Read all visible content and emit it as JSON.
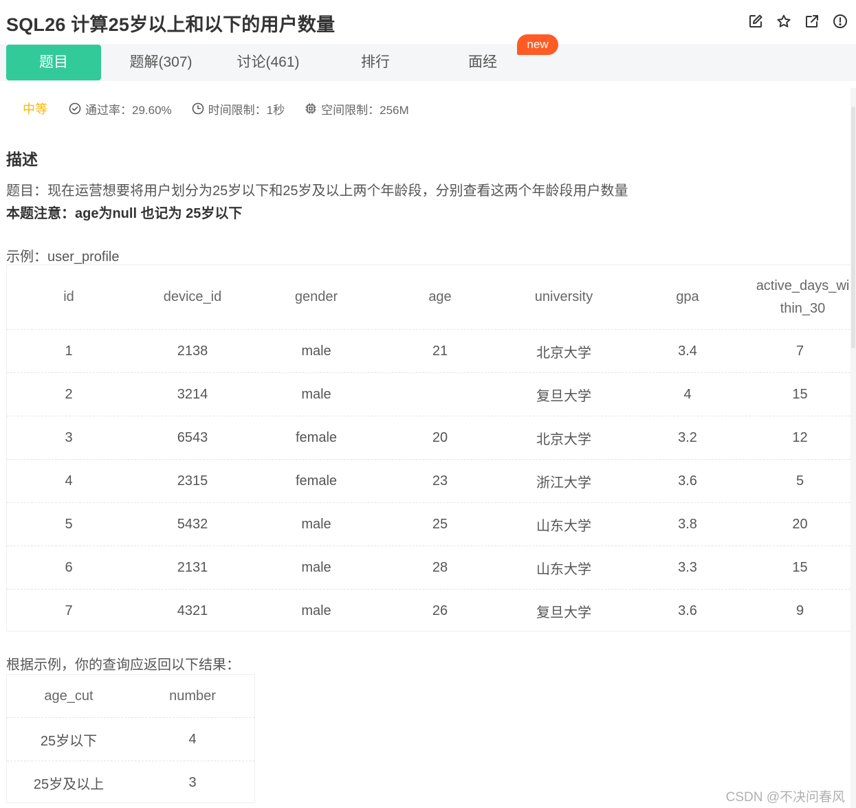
{
  "problem": {
    "title": "SQL26  计算25岁以上和以下的用户数量"
  },
  "header_actions": [
    {
      "icon": "edit-icon",
      "label": "编辑"
    },
    {
      "icon": "star-icon",
      "label": "收藏"
    },
    {
      "icon": "share-icon",
      "label": "分享"
    },
    {
      "icon": "report-icon",
      "label": "反馈"
    }
  ],
  "tabs": [
    {
      "label": "题目",
      "active": true
    },
    {
      "label": "题解(307)",
      "active": false
    },
    {
      "label": "讨论(461)",
      "active": false
    },
    {
      "label": "排行",
      "active": false
    },
    {
      "label": "面经",
      "active": false
    }
  ],
  "new_badge": "new",
  "meta": {
    "difficulty": "中等",
    "pass_rate": "通过率：29.60%",
    "time_limit": "时间限制：1秒",
    "space_limit": "空间限制：256M"
  },
  "description": {
    "heading": "描述",
    "text": "题目：现在运营想要将用户划分为25岁以下和25岁及以上两个年龄段，分别查看这两个年龄段用户数量",
    "note": "本题注意：age为null 也记为 25岁以下"
  },
  "example": {
    "label": "示例：user_profile",
    "columns": [
      "id",
      "device_id",
      "gender",
      "age",
      "university",
      "gpa",
      "active_days_within_30"
    ],
    "rows": [
      [
        "1",
        "2138",
        "male",
        "21",
        "北京大学",
        "3.4",
        "7"
      ],
      [
        "2",
        "3214",
        "male",
        "",
        "复旦大学",
        "4",
        "15"
      ],
      [
        "3",
        "6543",
        "female",
        "20",
        "北京大学",
        "3.2",
        "12"
      ],
      [
        "4",
        "2315",
        "female",
        "23",
        "浙江大学",
        "3.6",
        "5"
      ],
      [
        "5",
        "5432",
        "male",
        "25",
        "山东大学",
        "3.8",
        "20"
      ],
      [
        "6",
        "2131",
        "male",
        "28",
        "山东大学",
        "3.3",
        "15"
      ],
      [
        "7",
        "4321",
        "male",
        "26",
        "复旦大学",
        "3.6",
        "9"
      ]
    ]
  },
  "result": {
    "label": "根据示例，你的查询应返回以下结果：",
    "columns": [
      "age_cut",
      "number"
    ],
    "rows": [
      [
        "25岁以下",
        "4"
      ],
      [
        "25岁及以上",
        "3"
      ]
    ]
  },
  "watermark": "CSDN @不决问春风",
  "colors": {
    "accent": "#32ca99",
    "badge": "#ff5b24",
    "difficulty": "#ffb400"
  }
}
